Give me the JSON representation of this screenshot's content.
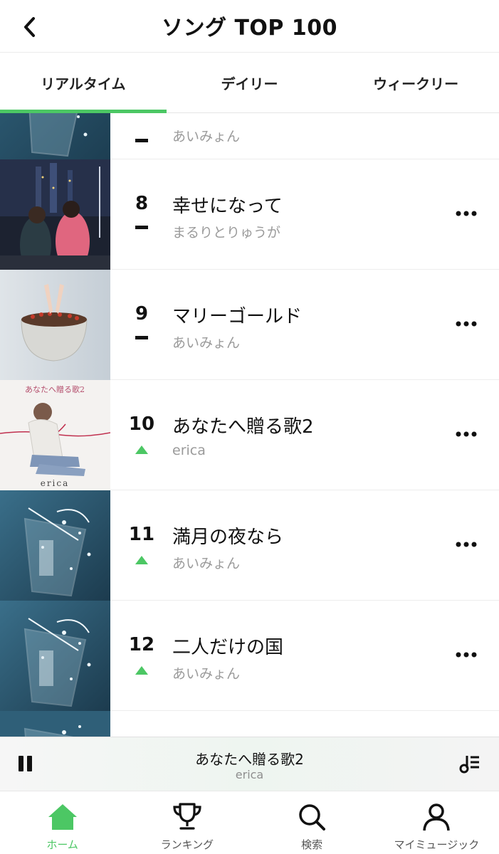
{
  "header": {
    "title": "ソング TOP 100",
    "back_icon": "chevron-left-icon"
  },
  "tabs": [
    {
      "label": "リアルタイム",
      "active": true
    },
    {
      "label": "デイリー",
      "active": false
    },
    {
      "label": "ウィークリー",
      "active": false
    }
  ],
  "colors": {
    "accent": "#4cc764",
    "rank_up": "#4cc764",
    "text_primary": "#111111",
    "text_secondary": "#9a9a9a"
  },
  "list": {
    "partial_top_row": {
      "rank": "",
      "trend": "same",
      "artist": "あいみょん",
      "art": "blue-glass"
    },
    "items": [
      {
        "rank": "8",
        "trend": "same",
        "title": "幸せになって",
        "artist": "まるりとりゅうが",
        "art": "night-city"
      },
      {
        "rank": "9",
        "trend": "same",
        "title": "マリーゴールド",
        "artist": "あいみょん",
        "art": "flower-pot"
      },
      {
        "rank": "10",
        "trend": "up",
        "title": "あなたへ贈る歌2",
        "artist": "erica",
        "art": "white-portrait",
        "art_text_top": "あなたへ贈る歌2",
        "art_text_bottom": "erica"
      },
      {
        "rank": "11",
        "trend": "up",
        "title": "満月の夜なら",
        "artist": "あいみょん",
        "art": "blue-glass"
      },
      {
        "rank": "12",
        "trend": "up",
        "title": "二人だけの国",
        "artist": "あいみょん",
        "art": "blue-glass"
      }
    ],
    "partial_bottom_row": {
      "art": "blue-glass"
    }
  },
  "player": {
    "title": "あなたへ贈る歌2",
    "artist": "erica",
    "state": "playing",
    "pause_icon": "pause-icon",
    "queue_icon": "playlist-icon"
  },
  "nav": [
    {
      "label": "ホーム",
      "icon": "home-icon",
      "active": true
    },
    {
      "label": "ランキング",
      "icon": "trophy-icon",
      "active": false
    },
    {
      "label": "検索",
      "icon": "search-icon",
      "active": false
    },
    {
      "label": "マイミュージック",
      "icon": "person-icon",
      "active": false
    }
  ]
}
